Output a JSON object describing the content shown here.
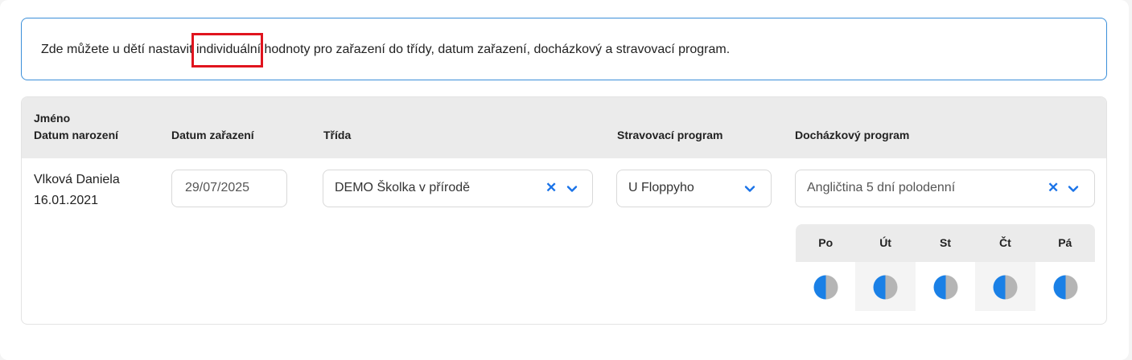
{
  "info": {
    "before": "Zde můžete u dětí nastavit ",
    "highlight": "individuální",
    "after": " hodnoty pro zařazení do třídy, datum zařazení, docházkový a stravovací program."
  },
  "table": {
    "headers": {
      "name": "Jméno",
      "birth": "Datum narození",
      "enroll_date": "Datum zařazení",
      "class": "Třída",
      "meal": "Stravovací program",
      "attendance": "Docházkový program"
    },
    "rows": [
      {
        "name": "Vlková Daniela",
        "birth": "16.01.2021",
        "enroll_date": "29/07/2025",
        "class": "DEMO Školka v přírodě",
        "meal": "U Floppyho",
        "attendance": "Angličtina 5 dní polodenní",
        "days": [
          "Po",
          "Út",
          "St",
          "Čt",
          "Pá"
        ]
      }
    ]
  },
  "colors": {
    "accent": "#1a73e8",
    "highlight_border": "#e0141e",
    "half_filled": "#1a80e6",
    "half_empty": "#b5b5b5"
  },
  "icons": {
    "clear": "close-icon",
    "dropdown": "chevron-down-icon",
    "attendance_half_day": "half-circle-icon"
  }
}
